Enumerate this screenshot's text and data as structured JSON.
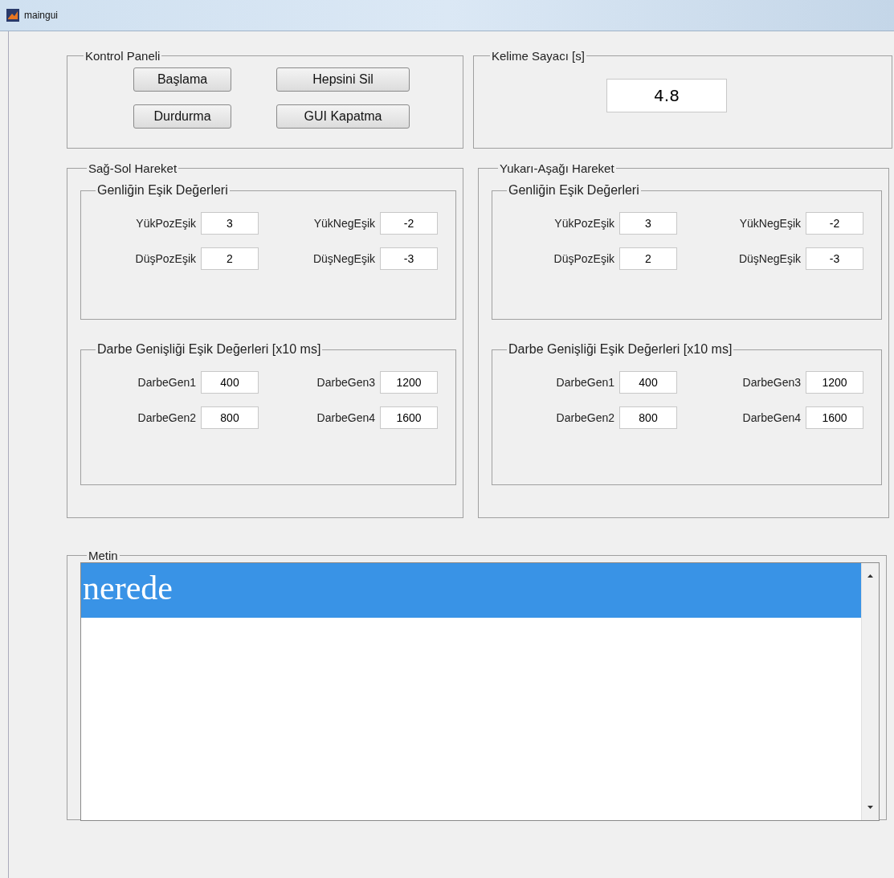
{
  "window": {
    "title": "maingui"
  },
  "control_panel": {
    "title": "Kontrol Paneli",
    "buttons": [
      "Başlama",
      "Hepsini Sil",
      "Durdurma",
      "GUI Kapatma"
    ]
  },
  "word_counter": {
    "title": "Kelime Sayacı [s]",
    "value": "4.8"
  },
  "motion_panels": [
    {
      "title": "Sağ-Sol Hareket",
      "groups": [
        {
          "title": "Genliğin Eşik Değerleri",
          "fields": [
            {
              "label": "YükPozEşik",
              "value": "3"
            },
            {
              "label": "YükNegEşik",
              "value": "-2"
            },
            {
              "label": "DüşPozEşik",
              "value": "2"
            },
            {
              "label": "DüşNegEşik",
              "value": "-3"
            }
          ]
        },
        {
          "title": "Darbe Genişliği Eşik Değerleri [x10 ms]",
          "fields": [
            {
              "label": "DarbeGen1",
              "value": "400"
            },
            {
              "label": "DarbeGen3",
              "value": "1200"
            },
            {
              "label": "DarbeGen2",
              "value": "800"
            },
            {
              "label": "DarbeGen4",
              "value": "1600"
            }
          ]
        }
      ]
    },
    {
      "title": "Yukarı-Aşağı Hareket",
      "groups": [
        {
          "title": "Genliğin Eşik Değerleri",
          "fields": [
            {
              "label": "YükPozEşik",
              "value": "3"
            },
            {
              "label": "YükNegEşik",
              "value": "-2"
            },
            {
              "label": "DüşPozEşik",
              "value": "2"
            },
            {
              "label": "DüşNegEşik",
              "value": "-3"
            }
          ]
        },
        {
          "title": "Darbe Genişliği Eşik Değerleri [x10 ms]",
          "fields": [
            {
              "label": "DarbeGen1",
              "value": "400"
            },
            {
              "label": "DarbeGen3",
              "value": "1200"
            },
            {
              "label": "DarbeGen2",
              "value": "800"
            },
            {
              "label": "DarbeGen4",
              "value": "1600"
            }
          ]
        }
      ]
    }
  ],
  "text_panel": {
    "title": "Metin",
    "items": [
      {
        "text": "nerede",
        "selected": true
      }
    ]
  }
}
